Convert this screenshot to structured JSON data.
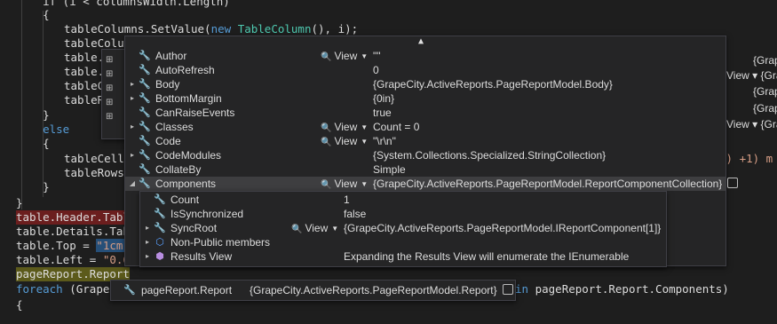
{
  "code": {
    "top_partial": "    if (i < columnsWidth.Length)",
    "l_brace1": "    {",
    "l_setvalue_a": "tableColumns.SetValue(",
    "l_setvalue_kw": "new",
    "l_setvalue_ty": "TableColumn",
    "l_setvalue_b": "(), i);",
    "l_col1": "tableColum",
    "l_col2": "table.",
    "l_col3": "table.",
    "l_col4": "tableC",
    "l_col5": "tableR",
    "l_brace2": "    }",
    "l_else": "    else",
    "l_brace3": "    {",
    "l_cells": "tableCells",
    "l_rows": "tableRows",
    "l_brace4": "    }",
    "l_brace5": "}",
    "l_header": "table.Header.Table",
    "l_details": "table.Details.Tabl",
    "l_top_a": "table.Top = ",
    "l_top_s": "\"1cm\"",
    "l_top_b": ";",
    "l_left_a": "table.Left = ",
    "l_left_s": "\"0.6",
    "l_pr": "pageReport.Report",
    "l_foreach_kw": "foreach",
    "l_foreach_a": " (GrapeC",
    "l_in_kw": "in",
    "l_foreach_b": " pageReport.Report.Components)",
    "l_brace6": "{",
    "right_end": "\") +1) m"
  },
  "right_fragments": [
    "{Grape",
    "View ▾ {Grape",
    "{Grape",
    "{Grape",
    "View ▾ {Grape"
  ],
  "tip_root": {
    "name": "pageReport.Report",
    "value": "{GrapeCity.ActiveReports.PageReportModel.Report}"
  },
  "tip_main": {
    "rows": [
      {
        "name": "Author",
        "view": "View",
        "value": "\"\"",
        "expand": "",
        "icon": "wrench"
      },
      {
        "name": "AutoRefresh",
        "view": "",
        "value": "0",
        "expand": "",
        "icon": "wrench"
      },
      {
        "name": "Body",
        "view": "",
        "value": "{GrapeCity.ActiveReports.PageReportModel.Body}",
        "expand": "▸",
        "icon": "wrench"
      },
      {
        "name": "BottomMargin",
        "view": "",
        "value": "{0in}",
        "expand": "▸",
        "icon": "wrench"
      },
      {
        "name": "CanRaiseEvents",
        "view": "",
        "value": "true",
        "expand": "",
        "icon": "key-wrench"
      },
      {
        "name": "Classes",
        "view": "View",
        "value": "Count = 0",
        "expand": "▸",
        "icon": "wrench"
      },
      {
        "name": "Code",
        "view": "View",
        "value": "\"\\r\\n\"",
        "expand": "",
        "icon": "wrench"
      },
      {
        "name": "CodeModules",
        "view": "",
        "value": "{System.Collections.Specialized.StringCollection}",
        "expand": "▸",
        "icon": "wrench"
      },
      {
        "name": "CollateBy",
        "view": "",
        "value": "Simple",
        "expand": "",
        "icon": "wrench"
      },
      {
        "name": "Components",
        "view": "View",
        "value": "{GrapeCity.ActiveReports.PageReportModel.ReportComponentCollection}",
        "expand": "◢",
        "icon": "wrench"
      }
    ],
    "sub_rows": [
      {
        "name": "Count",
        "view": "",
        "value": "1",
        "expand": "",
        "icon": "wrench"
      },
      {
        "name": "IsSynchronized",
        "view": "",
        "value": "false",
        "expand": "",
        "icon": "wrench"
      },
      {
        "name": "SyncRoot",
        "view": "View",
        "value": "{GrapeCity.ActiveReports.PageReportModel.IReportComponent[1]}",
        "expand": "▸",
        "icon": "wrench"
      },
      {
        "name": "Non-Public members",
        "view": "",
        "value": "",
        "expand": "▸",
        "icon": "cubes"
      },
      {
        "name": "Results View",
        "view": "",
        "value": "Expanding the Results View will enumerate the IEnumerable",
        "expand": "▸",
        "icon": "cube"
      }
    ]
  },
  "colors": {
    "keyword": "#569cd6",
    "type": "#4ec9b0",
    "string": "#d69d85",
    "popup_bg": "#252526"
  }
}
